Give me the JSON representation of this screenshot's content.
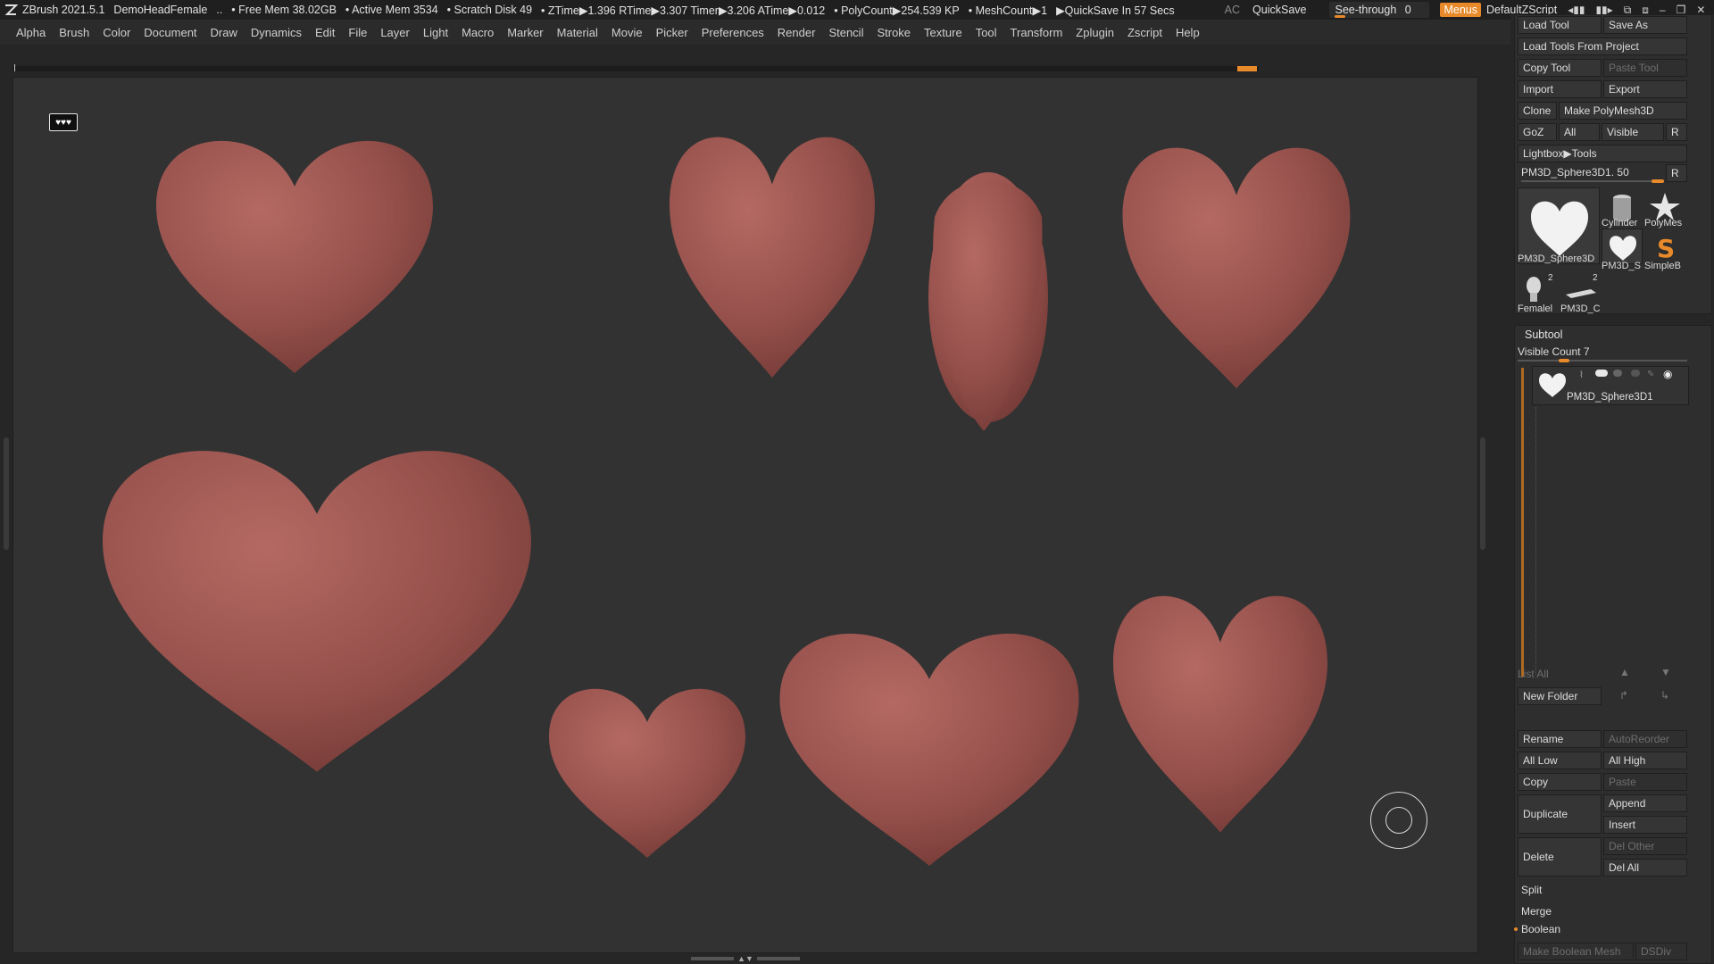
{
  "app": {
    "title": "ZBrush 2021.5.1",
    "document": "DemoHeadFemale",
    "status_items": [
      "..",
      "• Free Mem 38.02GB",
      "• Active Mem 3534",
      "• Scratch Disk 49",
      "• ZTime▶1.396 RTime▶3.307 Timer▶3.206 ATime▶0.012",
      "• PolyCount▶254.539 KP",
      "• MeshCount▶1",
      "▶QuickSave In 57 Secs"
    ],
    "ac_label": "AC",
    "quicksave_label": "QuickSave",
    "seethrough_label": "See-through",
    "seethrough_value": "0",
    "menus_label": "Menus",
    "script_label": "DefaultZScript"
  },
  "menubar": {
    "items": [
      "Alpha",
      "Brush",
      "Color",
      "Document",
      "Draw",
      "Dynamics",
      "Edit",
      "File",
      "Layer",
      "Light",
      "Macro",
      "Marker",
      "Material",
      "Movie",
      "Picker",
      "Preferences",
      "Render",
      "Stencil",
      "Stroke",
      "Texture",
      "Tool",
      "Transform",
      "Zplugin",
      "Zscript",
      "Help"
    ]
  },
  "canvas": {
    "heart_color": "#9a4f4b",
    "background": "#323232"
  },
  "tool_panel": {
    "load_tool": "Load Tool",
    "save_as": "Save As",
    "load_tools_from_project": "Load Tools From Project",
    "copy_tool": "Copy Tool",
    "paste_tool": "Paste Tool",
    "import": "Import",
    "export": "Export",
    "clone": "Clone",
    "make_polymesh": "Make PolyMesh3D",
    "goz": "GoZ",
    "all": "All",
    "visible": "Visible",
    "r": "R",
    "lightbox_tools": "Lightbox▶Tools",
    "current_tool": "PM3D_Sphere3D1. 50",
    "thumbs": [
      {
        "caption": "PM3D_Sphere3D",
        "icon": "heart-icon"
      },
      {
        "caption": "Cylinder",
        "icon": "cylinder-icon"
      },
      {
        "caption": "PolyMes",
        "icon": "star-icon"
      },
      {
        "caption": "PM3D_S",
        "icon": "heart-icon"
      },
      {
        "caption": "SimpleB",
        "icon": "brush-s-icon"
      },
      {
        "caption": "Femalel",
        "icon": "head-icon",
        "badge": "2"
      },
      {
        "caption": "PM3D_C",
        "icon": "plane-icon",
        "badge": "2"
      }
    ]
  },
  "subtool_panel": {
    "title": "Subtool",
    "visible_count": "Visible Count 7",
    "item_name": "PM3D_Sphere3D1",
    "list_all": "List All",
    "new_folder": "New Folder",
    "rename": "Rename",
    "auto_reorder": "AutoReorder",
    "all_low": "All Low",
    "all_high": "All High",
    "copy": "Copy",
    "paste": "Paste",
    "duplicate": "Duplicate",
    "append": "Append",
    "insert": "Insert",
    "delete": "Delete",
    "del_other": "Del Other",
    "del_all": "Del All",
    "split": "Split",
    "merge": "Merge",
    "boolean": "Boolean",
    "make_boolean_mesh": "Make Boolean Mesh",
    "dsdiv": "DSDiv"
  }
}
